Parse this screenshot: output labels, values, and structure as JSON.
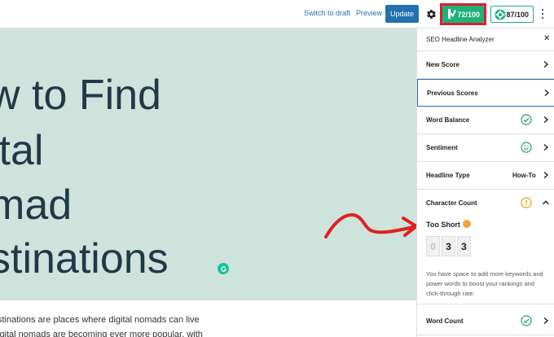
{
  "toolbar": {
    "switch_to_draft": "Switch to draft",
    "preview": "Preview",
    "update": "Update",
    "headline_score": "72/100",
    "seo_score": "87/100"
  },
  "editor": {
    "title_lines": [
      "w to Find",
      "ital",
      "mad",
      "stinations"
    ],
    "body_lines": [
      "stinations are places where digital nomads can live",
      "igital nomads are becoming ever more popular, with"
    ]
  },
  "sidebar": {
    "title": "SEO Headline Analyzer",
    "rows": [
      {
        "label": "New Score"
      },
      {
        "label": "Previous Scores"
      },
      {
        "label": "Word Balance"
      },
      {
        "label": "Sentiment"
      },
      {
        "label": "Headline Type",
        "value": "How-To"
      },
      {
        "label": "Character Count"
      }
    ],
    "character_count": {
      "status": "Too Short",
      "digits": [
        "0",
        "3",
        "3"
      ],
      "help": "You have space to add more keywords and power words to boost your rankings and click-through rate."
    },
    "word_count": {
      "label": "Word Count"
    }
  },
  "colors": {
    "accent_blue": "#2271b1",
    "score_green": "#21b07a",
    "highlight_red": "#d6202f",
    "hero_bg": "#cfe3dd",
    "annotation_arrow": "#e02020"
  }
}
